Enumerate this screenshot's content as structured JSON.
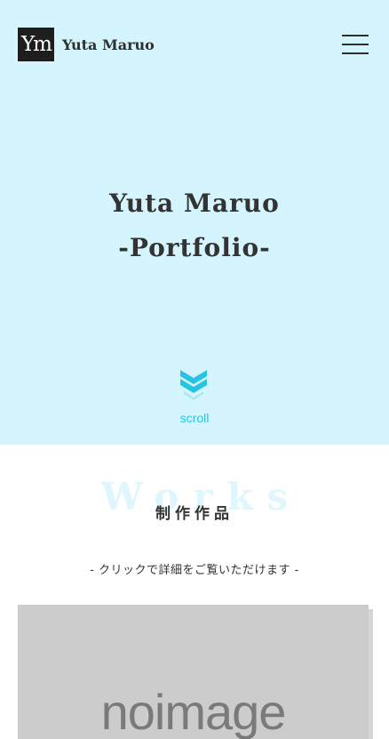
{
  "header": {
    "logo_mark": "Ym",
    "logo_text": "Yuta Maruo",
    "menu_icon": "hamburger-menu-icon"
  },
  "hero": {
    "title_line1": "Yuta Maruo",
    "title_line2": "-Portfolio-",
    "background_color": "#d4f5fd",
    "scroll_icon": "double-chevron-down-icon",
    "scroll_label": "scroll",
    "accent_color": "#28c3e3"
  },
  "works": {
    "background_title": "Works",
    "heading": "制作作品",
    "note": "- クリックで詳細をご覧いただけます -",
    "items": [
      {
        "image_text": "noimage"
      }
    ]
  }
}
